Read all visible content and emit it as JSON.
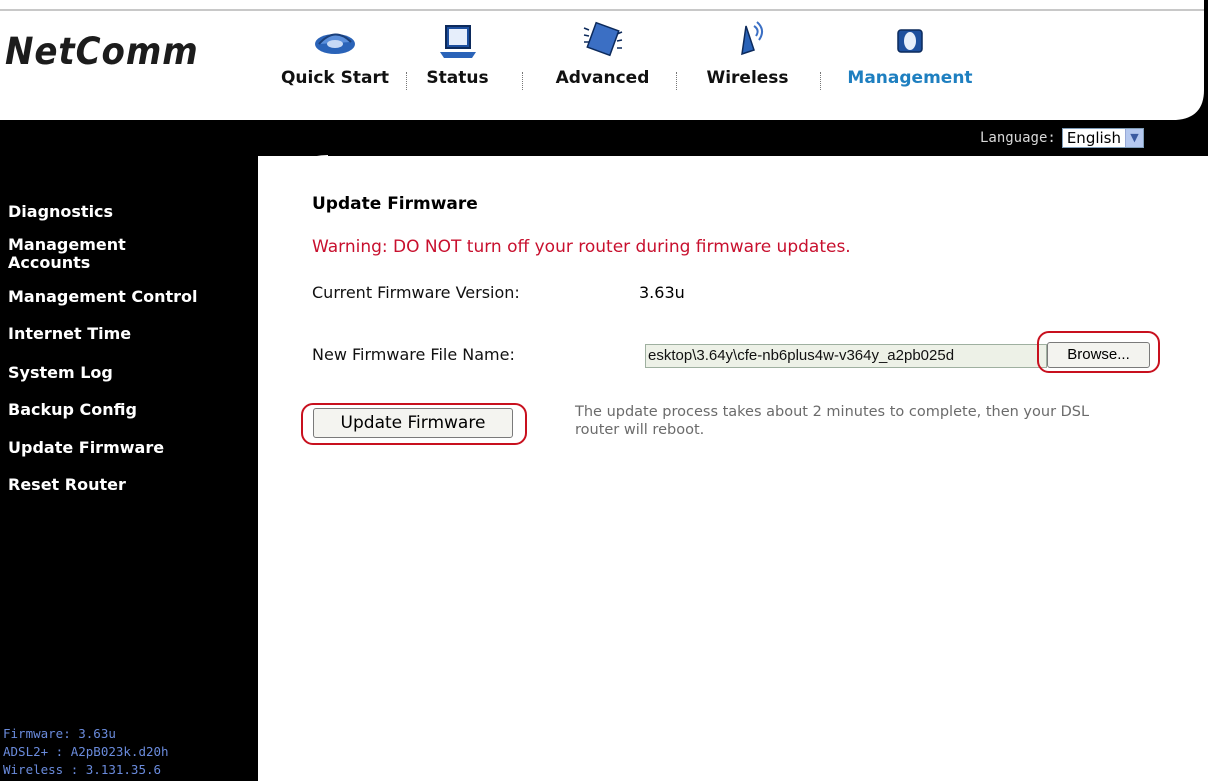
{
  "brand": {
    "logo_text": "NetComm"
  },
  "nav": {
    "items": [
      {
        "label": "Quick Start",
        "icon": "quick-start-icon"
      },
      {
        "label": "Status",
        "icon": "laptop-status-icon"
      },
      {
        "label": "Advanced",
        "icon": "chip-advanced-icon"
      },
      {
        "label": "Wireless",
        "icon": "antenna-wireless-icon"
      },
      {
        "label": "Management",
        "icon": "management-icon",
        "active": true
      }
    ]
  },
  "language": {
    "label": "Language:",
    "selected": "English"
  },
  "sidebar": {
    "items": [
      {
        "label": "Diagnostics"
      },
      {
        "label": "Management\nAccounts"
      },
      {
        "label": "Management Control"
      },
      {
        "label": "Internet Time"
      },
      {
        "label": "System Log"
      },
      {
        "label": "Backup Config"
      },
      {
        "label": "Update Firmware"
      },
      {
        "label": "Reset Router"
      }
    ],
    "info": {
      "firmware": "Firmware: 3.63u",
      "adsl": "ADSL2+ : A2pB023k.d20h",
      "wireless": "Wireless : 3.131.35.6"
    }
  },
  "main": {
    "title": "Update Firmware",
    "warning": "Warning: DO NOT turn off your router during firmware updates.",
    "current_label": "Current Firmware Version:",
    "current_value": "3.63u",
    "new_label": "New Firmware File Name:",
    "file_value": "esktop\\3.64y\\cfe-nb6plus4w-v364y_a2pb025d",
    "browse_label": "Browse...",
    "update_button": "Update Firmware",
    "note": "The update process takes about 2 minutes to complete, then your DSL router will reboot."
  },
  "colors": {
    "active_nav": "#1e7fc0",
    "warning": "#c8102e",
    "highlight_ring": "#c8101e",
    "sidebar_bg": "#000000",
    "info_text": "#6a8bdc"
  }
}
